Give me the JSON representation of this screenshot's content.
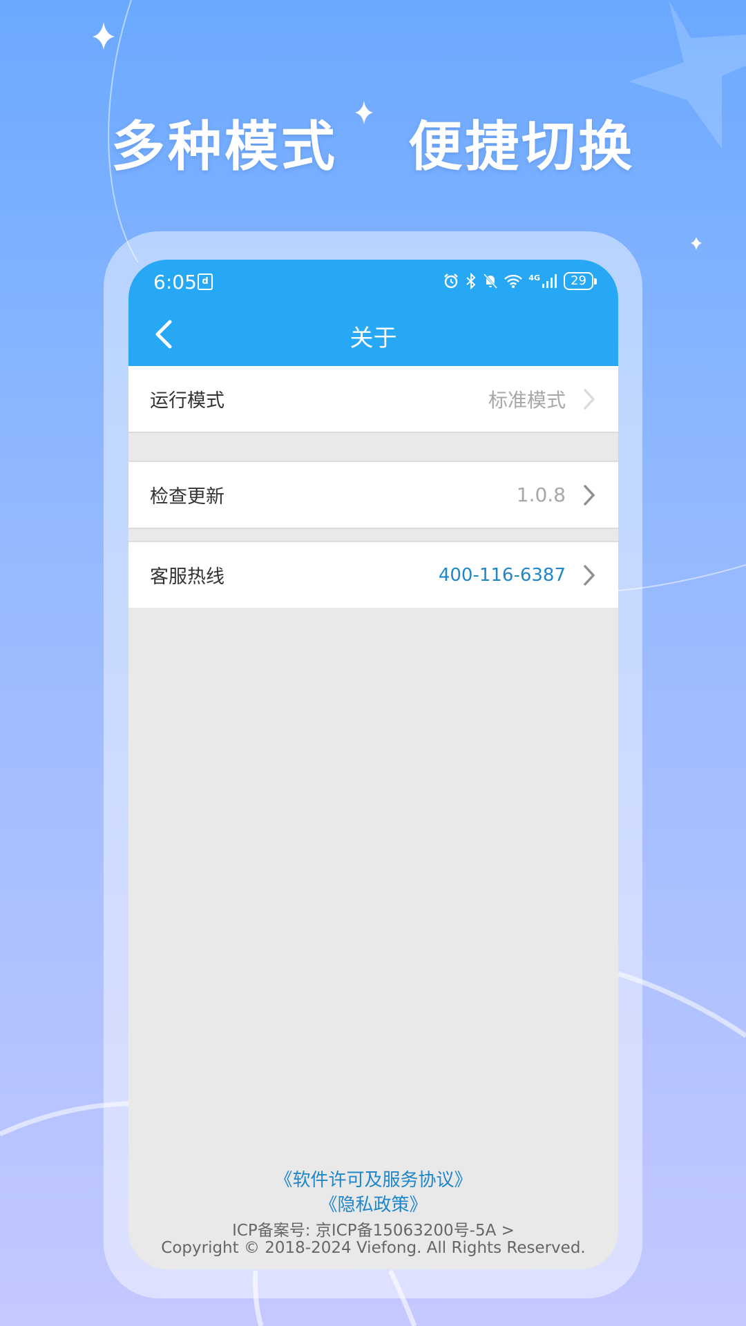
{
  "headline": {
    "left": "多种模式",
    "right": "便捷切换"
  },
  "status_bar": {
    "time": "6:05",
    "sim_label": "d",
    "network": "4G",
    "battery": "29"
  },
  "header": {
    "title": "关于"
  },
  "settings": {
    "mode": {
      "label": "运行模式",
      "value": "标准模式"
    },
    "update": {
      "label": "检查更新",
      "value": "1.0.8"
    },
    "hotline": {
      "label": "客服热线",
      "value": "400-116-6387"
    }
  },
  "footer": {
    "license_link": "《软件许可及服务协议》",
    "privacy_link": "《隐私政策》",
    "icp": "ICP备案号: 京ICP备15063200号-5A >",
    "copyright": "Copyright © 2018-2024 Viefong. All Rights Reserved."
  },
  "colors": {
    "appbar": "#27a8f4",
    "link_blue": "#1f86c9",
    "background_top": "#6aa9ff",
    "background_bottom": "#c4c8ff"
  },
  "icons": [
    "sparkle-icon",
    "star-icon",
    "alarm-icon",
    "bluetooth-icon",
    "mute-icon",
    "wifi-icon",
    "signal-icon",
    "battery-icon",
    "back-arrow-icon",
    "chevron-right-icon"
  ]
}
